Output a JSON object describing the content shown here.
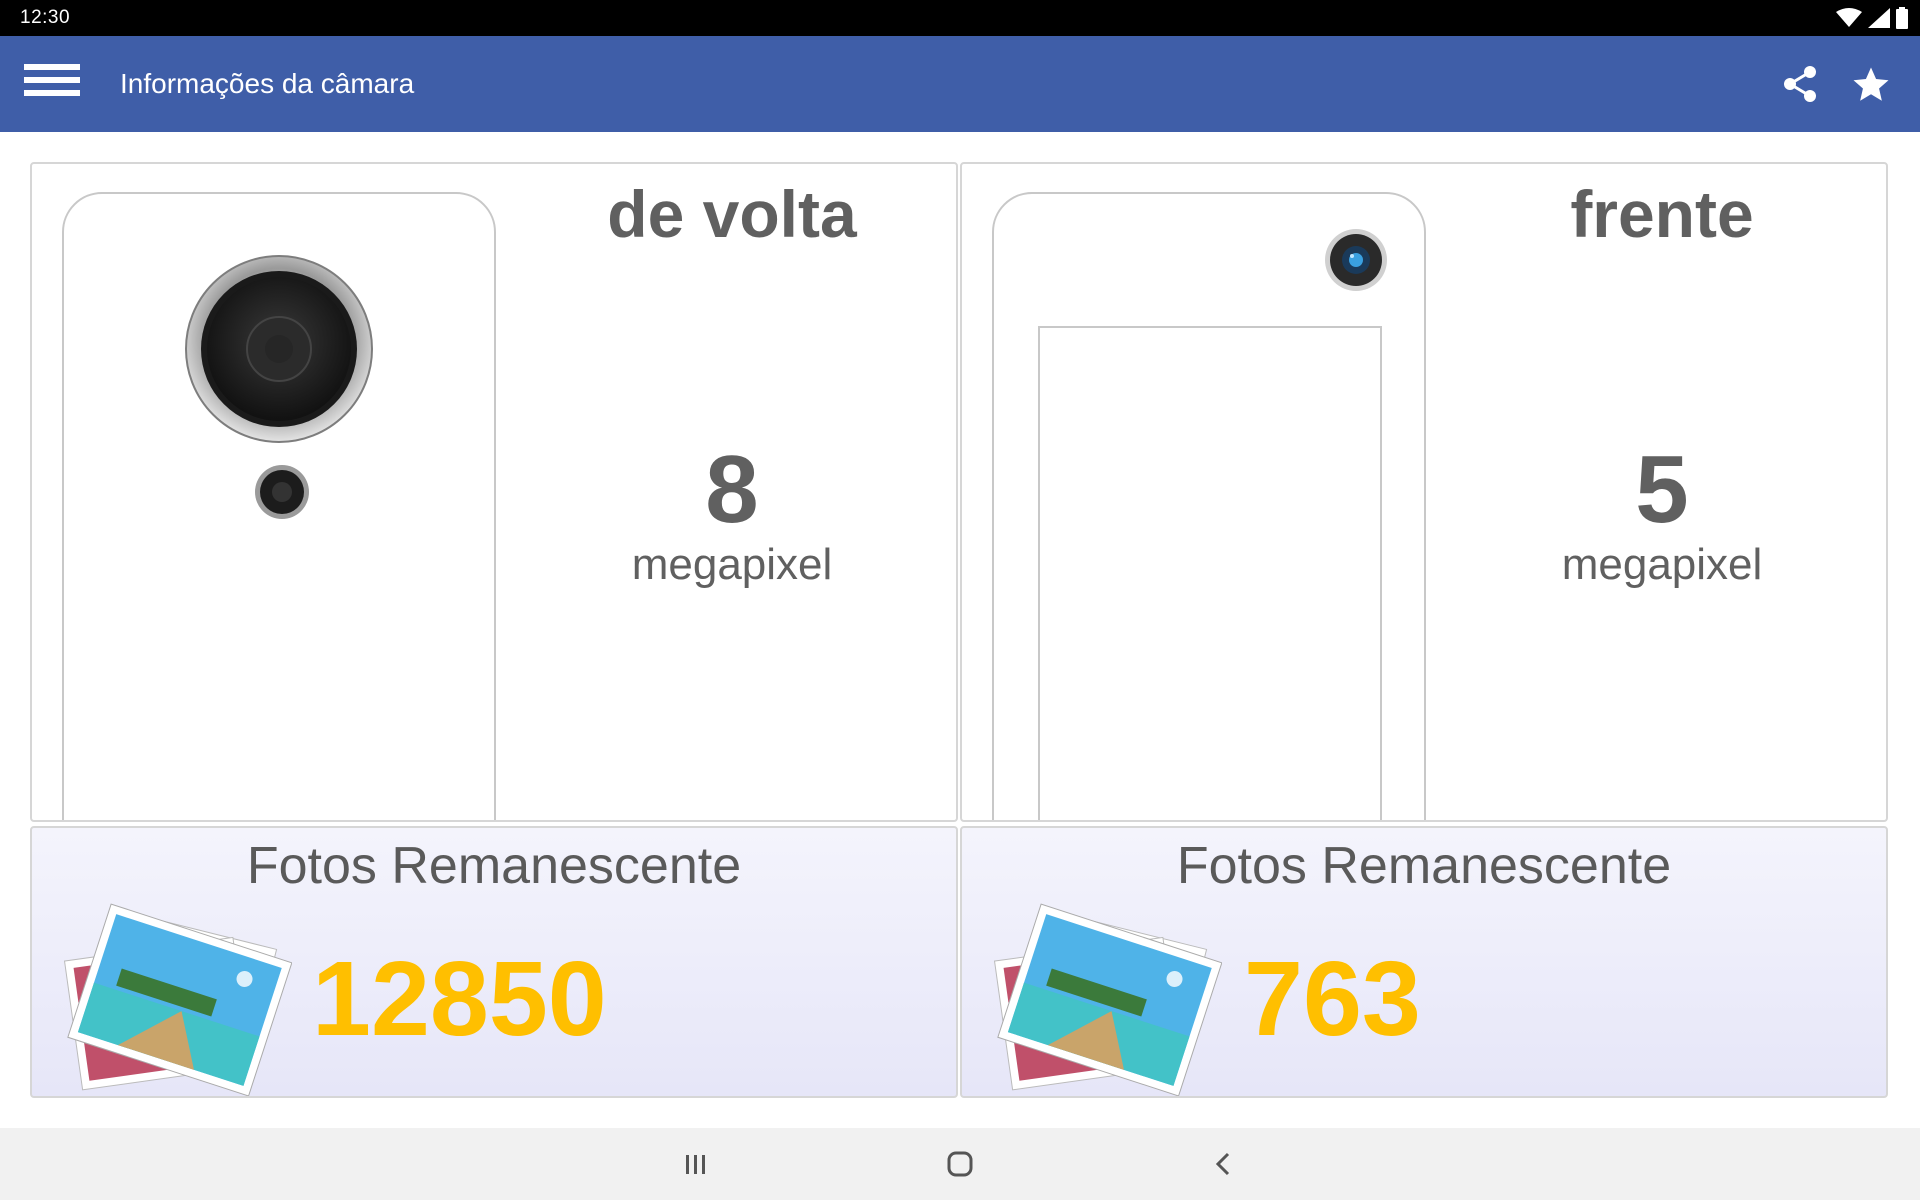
{
  "status_bar": {
    "time": "12:30",
    "icons": [
      "wifi-icon",
      "signal-icon",
      "battery-icon"
    ]
  },
  "app_bar": {
    "title": "Informações da câmara",
    "background": "#3f5ea8",
    "actions": [
      "share-icon",
      "star-icon"
    ]
  },
  "cameras": [
    {
      "side": "de volta",
      "megapixels": "8",
      "unit": "megapixel",
      "photos_label": "Fotos Remanescente",
      "photos_remaining": "12850"
    },
    {
      "side": "frente",
      "megapixels": "5",
      "unit": "megapixel",
      "photos_label": "Fotos Remanescente",
      "photos_remaining": "763"
    }
  ],
  "colors": {
    "accent_count": "#ffbf00",
    "text_gray": "#606060"
  },
  "nav_bar": {
    "buttons": [
      "recents-icon",
      "home-icon",
      "back-icon"
    ]
  }
}
